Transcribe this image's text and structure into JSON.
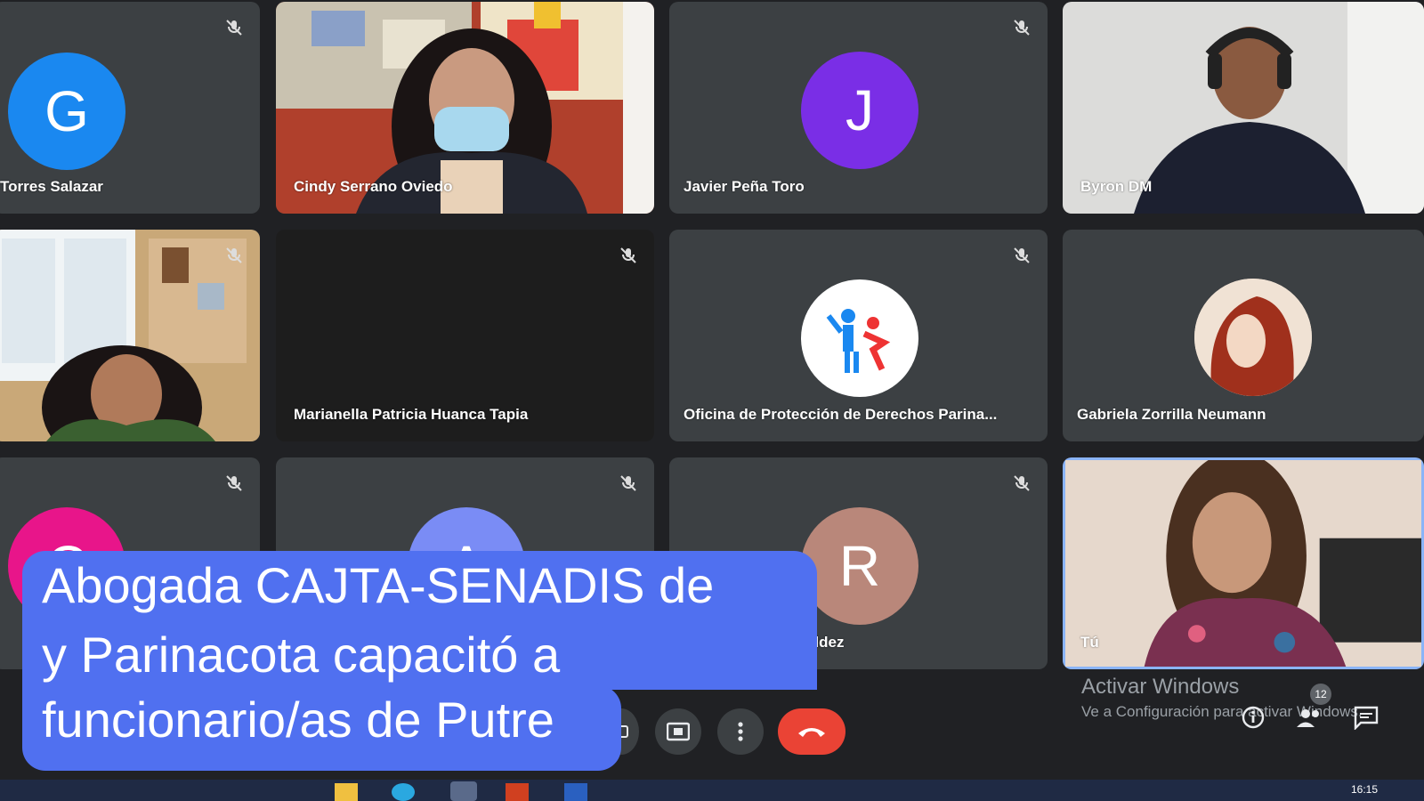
{
  "participants": [
    {
      "name": "Torres Salazar",
      "initial": "G",
      "color": "#1a88f0",
      "muted": true
    },
    {
      "name": "Cindy Serrano Oviedo",
      "video": true
    },
    {
      "name": "Javier Peña Toro",
      "initial": "J",
      "color": "#7a2ee6",
      "muted": true
    },
    {
      "name": "Byron DM",
      "video": true
    },
    {
      "name": "",
      "video": true,
      "muted": true
    },
    {
      "name": "Marianella Patricia Huanca Tapia",
      "muted": true
    },
    {
      "name": "Oficina de Protección de Derechos Parina...",
      "muted": true
    },
    {
      "name": "Gabriela Zorrilla Neumann"
    },
    {
      "initial": "C",
      "color": "#e8158a",
      "muted": true
    },
    {
      "initial": "A",
      "color": "#7a8cf5",
      "muted": true
    },
    {
      "name": "Rosario Padilla Valdez",
      "initial": "R",
      "color": "#b9877a",
      "muted": true
    },
    {
      "name": "Tú",
      "video": true
    }
  ],
  "caption": {
    "line1": "Abogada CAJTA-SENADIS de Arica",
    "line2": "y Parinacota capacitó a",
    "line3": "funcionario/as de Putre"
  },
  "windows": {
    "activate_title": "Activar Windows",
    "activate_sub": "Ve a Configuración para activar Windows.",
    "clock": "16:15"
  },
  "people_count": "12",
  "colors": {
    "caption_bg": "#5070f0",
    "end_call": "#ea4335",
    "tile_bg": "#3c4043",
    "active_border": "#8ab4f8"
  }
}
